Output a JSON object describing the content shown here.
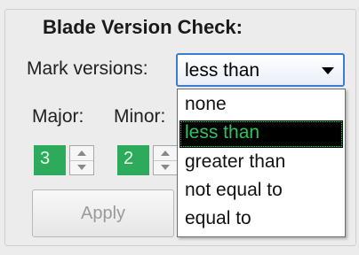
{
  "group": {
    "title": "Blade Version Check:"
  },
  "mark_versions": {
    "label": "Mark versions:",
    "selected": "less than",
    "options": [
      "none",
      "less than",
      "greater than",
      "not equal to",
      "equal to"
    ]
  },
  "major": {
    "label": "Major:",
    "value": "3"
  },
  "minor": {
    "label": "Minor:",
    "value": "2"
  },
  "apply": {
    "label": "Apply"
  },
  "colors": {
    "accent": "#3b7ecf",
    "spin_bg": "#2eaa5c",
    "highlight_text": "#2fc35f"
  }
}
